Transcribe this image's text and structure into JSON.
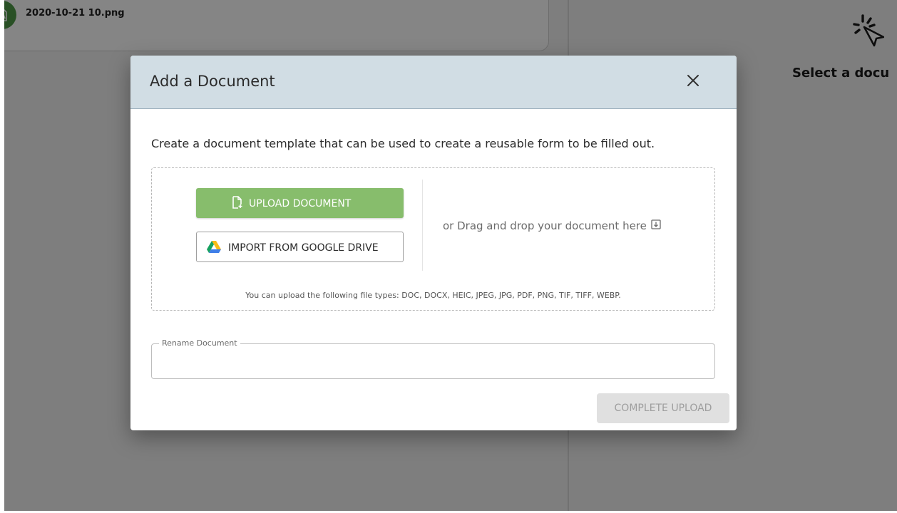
{
  "background": {
    "file_card": {
      "file_name": "2020-10-21 10.png"
    },
    "right_panel": {
      "title": "Select a docu"
    }
  },
  "modal": {
    "title": "Add a Document",
    "intro": "Create a document template that can be used to create a reusable form to be filled out.",
    "upload_button_label": "UPLOAD DOCUMENT",
    "google_drive_button_label": "IMPORT FROM GOOGLE DRIVE",
    "drag_drop_text": "or Drag and drop your document here",
    "file_types_text": "You can upload the following file types: DOC, DOCX, HEIC, JPEG, JPG, PDF, PNG, TIF, TIFF, WEBP.",
    "rename_label": "Rename Document",
    "rename_value": "",
    "complete_button_label": "COMPLETE UPLOAD"
  },
  "icons": {
    "file": "image-file-icon",
    "select_cursor": "cursor-click-icon",
    "close": "close-icon",
    "upload": "file-add-icon",
    "google_drive": "google-drive-icon",
    "drop": "download-box-icon"
  },
  "colors": {
    "header_bg": "#d1dde4",
    "upload_button": "#87bd6c",
    "file_badge": "#4f9a48",
    "disabled_button_bg": "#e0e0e0",
    "disabled_button_text": "#9e9e9e"
  }
}
